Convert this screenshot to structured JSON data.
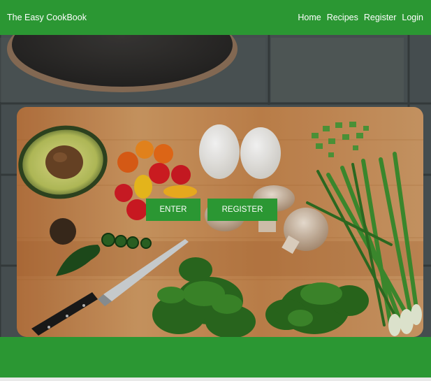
{
  "navbar": {
    "brand": "The Easy CookBook",
    "links": [
      "Home",
      "Recipes",
      "Register",
      "Login"
    ]
  },
  "hero": {
    "image_icon": "cutting-board-food-photo",
    "enter_label": "ENTER",
    "register_label": "REGISTER"
  },
  "colors": {
    "brand_green": "#2b9733",
    "board_wood": "#c98a55"
  }
}
